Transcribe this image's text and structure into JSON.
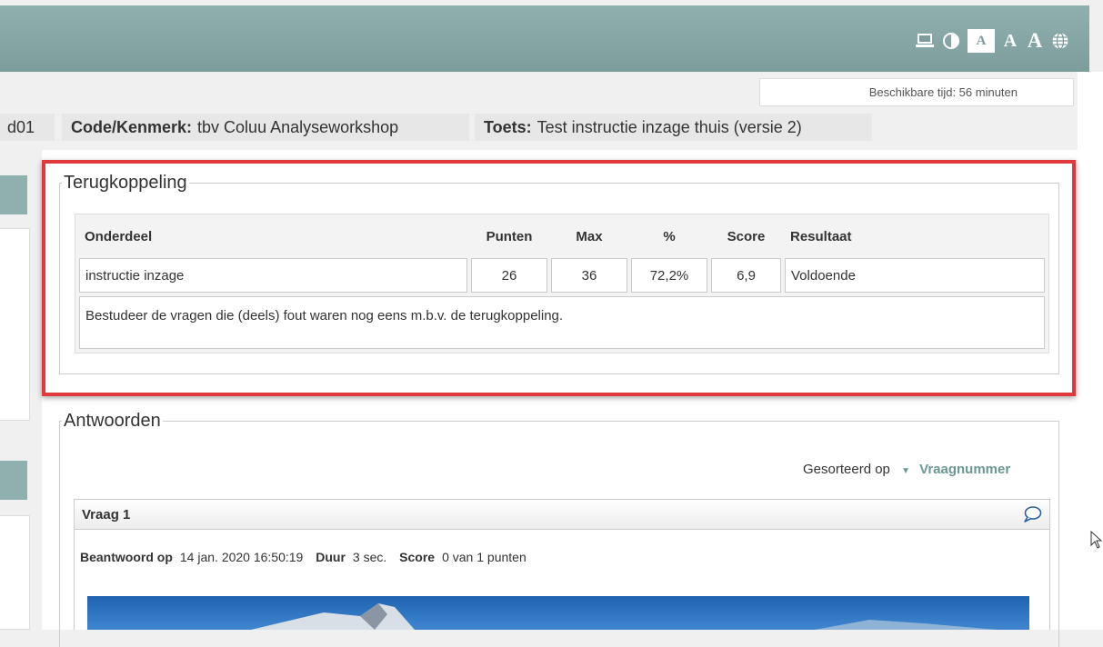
{
  "toolbar": {
    "icons": [
      "laptop-icon",
      "contrast-icon",
      "font-size-small-icon",
      "font-size-medium-icon",
      "font-size-large-icon",
      "globe-icon"
    ],
    "font_small": "A",
    "font_medium": "A",
    "font_large": "A"
  },
  "available_time": "Beschikbare tijd: 56 minuten",
  "tabs": {
    "partial": "d01",
    "code_label": "Code/Kenmerk:",
    "code_value": "tbv Coluu Analyseworkshop",
    "test_label": "Toets:",
    "test_value": "Test instructie inzage thuis (versie 2)"
  },
  "feedback": {
    "legend": "Terugkoppeling",
    "headers": [
      "Onderdeel",
      "Punten",
      "Max",
      "%",
      "Score",
      "Resultaat"
    ],
    "row": [
      "instructie inzage",
      "26",
      "36",
      "72,2%",
      "6,9",
      "Voldoende"
    ],
    "message": "Bestudeer de vragen die (deels) fout waren nog eens m.b.v. de terugkoppeling."
  },
  "answers": {
    "legend": "Antwoorden",
    "sorted_label": "Gesorteerd op",
    "sorted_value": "Vraagnummer",
    "question_title": "Vraag 1",
    "answered_label": "Beantwoord op",
    "answered_value": "14 jan. 2020 16:50:19",
    "duration_label": "Duur",
    "duration_value": "3 sec.",
    "score_label": "Score",
    "score_value": "0 van 1 punten"
  },
  "colors": {
    "header_teal": "#7c9d9b",
    "highlight_red": "#e0393c",
    "link_teal": "#6b9795"
  }
}
